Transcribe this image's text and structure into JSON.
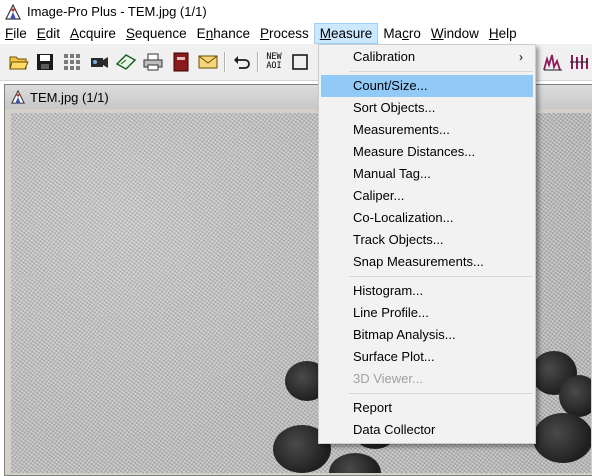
{
  "window": {
    "title": "Image-Pro Plus - TEM.jpg (1/1)"
  },
  "menubar": {
    "items": [
      {
        "label": "File",
        "underline": "F",
        "rest": "ile"
      },
      {
        "label": "Edit",
        "underline": "E",
        "rest": "dit"
      },
      {
        "label": "Acquire",
        "underline": "A",
        "rest": "cquire"
      },
      {
        "label": "Sequence",
        "underline": "S",
        "rest": "equence"
      },
      {
        "label": "Enhance",
        "pre": "E",
        "underline": "n",
        "rest": "hance"
      },
      {
        "label": "Process",
        "underline": "P",
        "rest": "rocess"
      },
      {
        "label": "Measure",
        "underline": "M",
        "rest": "easure"
      },
      {
        "label": "Macro",
        "pre": "Ma",
        "underline": "c",
        "rest": "ro"
      },
      {
        "label": "Window",
        "underline": "W",
        "rest": "indow"
      },
      {
        "label": "Help",
        "underline": "H",
        "rest": "elp"
      }
    ],
    "active": "Measure"
  },
  "toolbar": {
    "new_aoi_label_top": "NEW",
    "new_aoi_label_bottom": "AOI"
  },
  "document": {
    "title": "TEM.jpg (1/1)"
  },
  "measure_menu": {
    "items": [
      {
        "label": "Calibration",
        "submenu": true
      },
      {
        "label": "Count/Size...",
        "highlighted": true
      },
      {
        "label": "Sort Objects..."
      },
      {
        "label": "Measurements..."
      },
      {
        "label": "Measure Distances..."
      },
      {
        "label": "Manual Tag..."
      },
      {
        "label": "Caliper..."
      },
      {
        "label": "Co-Localization..."
      },
      {
        "label": "Track Objects..."
      },
      {
        "label": "Snap Measurements..."
      },
      {
        "label": "Histogram..."
      },
      {
        "label": "Line Profile..."
      },
      {
        "label": "Bitmap Analysis..."
      },
      {
        "label": "Surface Plot..."
      },
      {
        "label": "3D Viewer...",
        "disabled": true
      },
      {
        "label": "Report"
      },
      {
        "label": "Data Collector"
      }
    ],
    "submenu_arrow": "›"
  },
  "colors": {
    "menu_highlight": "#91c9f7",
    "active_menu_bg": "#cce8ff",
    "disabled_text": "#a0a0a0"
  }
}
